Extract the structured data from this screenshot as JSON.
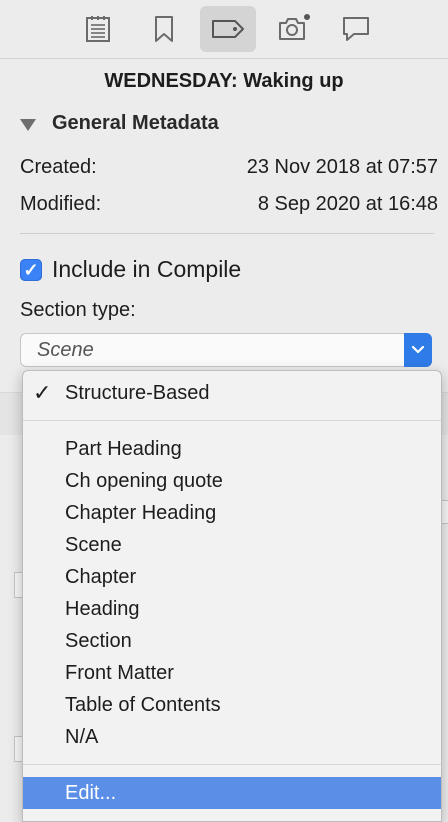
{
  "toolbar": {
    "icons": [
      "notes-icon",
      "bookmark-icon",
      "metadata-tag-icon",
      "snapshot-camera-icon",
      "comments-icon"
    ],
    "active": "metadata-tag-icon"
  },
  "document": {
    "title": "WEDNESDAY: Waking up"
  },
  "general_metadata": {
    "header": "General Metadata",
    "created_label": "Created:",
    "created_value": "23 Nov 2018 at 07:57",
    "modified_label": "Modified:",
    "modified_value": "8 Sep 2020 at 16:48"
  },
  "compile": {
    "include_label": "Include in Compile",
    "checked": true
  },
  "section_type": {
    "label": "Section type:",
    "current_value": "Scene"
  },
  "menu": {
    "checkmark": "✓",
    "top_item": "Structure-Based",
    "items": [
      "Part Heading",
      "Ch opening quote",
      "Chapter Heading",
      "Scene",
      "Chapter",
      "Heading",
      "Section",
      "Front Matter",
      "Table of Contents",
      "N/A"
    ],
    "edit_item": "Edit..."
  },
  "colors": {
    "accent": "#2f7ce8",
    "highlight": "#5b8ee6"
  }
}
